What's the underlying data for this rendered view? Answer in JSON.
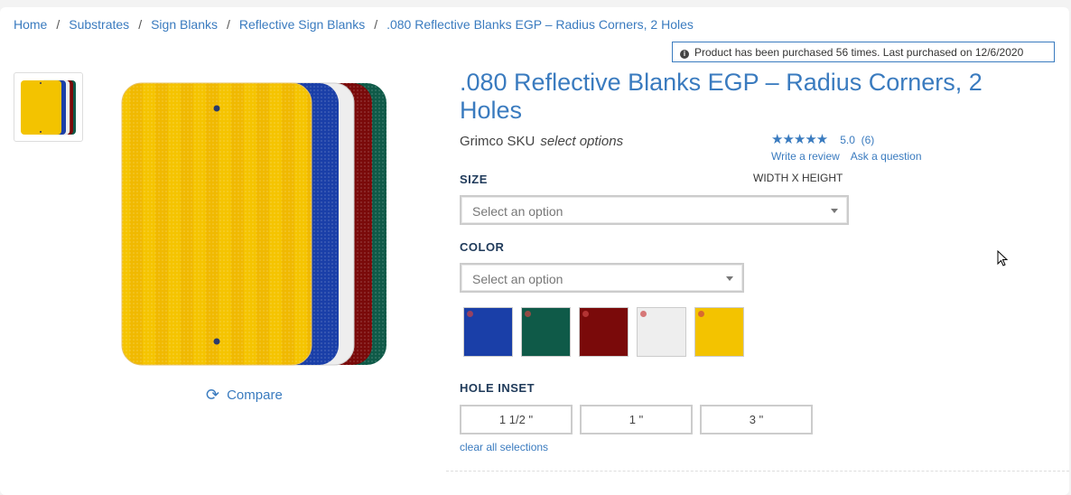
{
  "breadcrumb": {
    "items": [
      "Home",
      "Substrates",
      "Sign Blanks",
      "Reflective Sign Blanks",
      ".080 Reflective Blanks EGP – Radius Corners, 2 Holes"
    ],
    "separator": "/"
  },
  "notice": {
    "icon": "info-icon",
    "text": "Product has been purchased 56 times. Last purchased on 12/6/2020"
  },
  "product": {
    "title": ".080 Reflective Blanks EGP – Radius Corners, 2 Holes",
    "sku_label": "Grimco SKU",
    "sku_value": "select options",
    "rating_value": "5.0",
    "rating_count": "(6)",
    "write_review": "Write a review",
    "ask_question": "Ask a question",
    "compare": "Compare"
  },
  "size": {
    "label": "SIZE",
    "hint": "WIDTH X HEIGHT",
    "placeholder": "Select an option"
  },
  "color": {
    "label": "COLOR",
    "placeholder": "Select an option",
    "swatches": [
      {
        "name": "blue",
        "hex": "#1a3fa8"
      },
      {
        "name": "green",
        "hex": "#0f5a48"
      },
      {
        "name": "red",
        "hex": "#7a0a0a"
      },
      {
        "name": "white",
        "hex": "#eeeeee"
      },
      {
        "name": "yellow",
        "hex": "#f3c300"
      }
    ]
  },
  "hole_inset": {
    "label": "HOLE INSET",
    "options": [
      "1 1/2 \"",
      "1 \"",
      "3 \""
    ],
    "clear": "clear all selections"
  },
  "colors": {
    "accent": "#3a7bbf",
    "heading": "#1f3a5a"
  }
}
